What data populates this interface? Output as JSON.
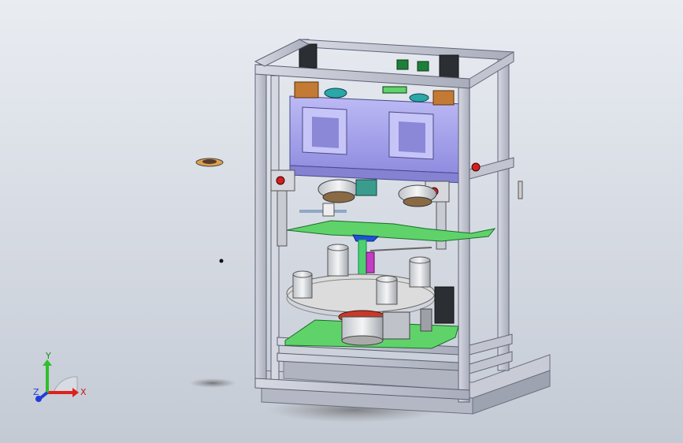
{
  "viewport": {
    "background_top": "#e9edf2",
    "background_bottom": "#c4cad4"
  },
  "model": {
    "frame_color": "#c8cbd6",
    "upper_block_color": "#a9a7ef",
    "pcb_color": "#5fd36a",
    "motor_color": "#2b2f33",
    "turntable_color": "#dcdcdc"
  },
  "triad": {
    "x_label": "X",
    "y_label": "Y",
    "z_label": "Z",
    "x_color": "#e0201b",
    "y_color": "#2fbf2f",
    "z_color": "#1f3fd6"
  }
}
